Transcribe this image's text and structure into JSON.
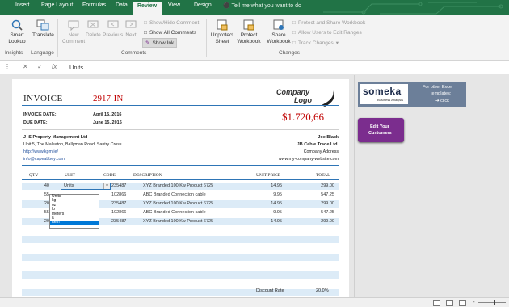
{
  "ribbon_tabs": [
    "Insert",
    "Page Layout",
    "Formulas",
    "Data",
    "Review",
    "View",
    "Design"
  ],
  "active_tab": "Review",
  "tell_me": "Tell me what you want to do",
  "ribbon": {
    "smart_lookup": "Smart Lookup",
    "translate": "Translate",
    "new_comment": "New Comment",
    "delete": "Delete",
    "previous": "Previous",
    "next": "Next",
    "show_hide_comment": "Show/Hide Comment",
    "show_all_comments": "Show All Comments",
    "show_ink": "Show Ink",
    "unprotect_sheet": "Unprotect Sheet",
    "protect_workbook": "Protect Workbook",
    "share_workbook": "Share Workbook",
    "protect_share_workbook": "Protect and Share Workbook",
    "allow_users": "Allow Users to Edit Ranges",
    "track_changes": "Track Changes",
    "groups": [
      "Insights",
      "Language",
      "Comments",
      "Changes"
    ]
  },
  "formula_bar": {
    "value": "Units"
  },
  "invoice": {
    "title": "INVOICE",
    "number": "2917-IN",
    "logo_line1": "Company",
    "logo_line2": "Logo",
    "invoice_date_label": "INVOICE DATE:",
    "invoice_date": "April 15, 2016",
    "due_date_label": "DUE DATE:",
    "due_date": "June 15, 2016",
    "total_big": "$1.720,66",
    "from": {
      "name": "J+S Property Management Ltd",
      "address": "Unit 5, The Maleaton, Ballyman Road, Santry Cross",
      "web": "http://www.kpm.ie/",
      "email": "info@capeabbey.com"
    },
    "to": {
      "person": "Joe Black",
      "company": "JB Cable Trade Ltd.",
      "address": "Company Address",
      "web": "www.my-company-website.com"
    },
    "headers": [
      "QTY",
      "UNIT",
      "CODE",
      "DESCRIPTION",
      "UNIT PRICE",
      "TOTAL"
    ],
    "rows": [
      {
        "qty": "40",
        "unit": "Units",
        "code": "235487",
        "desc": "XYZ Branded 100 Kw Product 6725",
        "price": "14.95",
        "total": "299.00"
      },
      {
        "qty": "55",
        "unit": "",
        "code": "102866",
        "desc": "ABC Branded Connection cable",
        "price": "9.95",
        "total": "547.25"
      },
      {
        "qty": "20",
        "unit": "",
        "code": "235487",
        "desc": "XYZ Branded 100 Kw Product 6725",
        "price": "14.95",
        "total": "299.00"
      },
      {
        "qty": "55",
        "unit": "",
        "code": "102866",
        "desc": "ABC Branded Connection cable",
        "price": "9.95",
        "total": "547.25"
      },
      {
        "qty": "20",
        "unit": "Units",
        "code": "235487",
        "desc": "XYZ Branded 100 Kw Product 6725",
        "price": "14.95",
        "total": "299.00"
      }
    ],
    "unit_options": [
      "Units",
      "kg",
      "oz",
      "lb",
      "meters",
      "ft",
      "Item"
    ],
    "unit_selected": "Item",
    "discount_label": "Discount Rate",
    "discount_value": "20.0%"
  },
  "promo": {
    "brand": "someka",
    "brand_sub": "Business Analysis",
    "text1": "For other Excel",
    "text2": "templates:",
    "link": "click"
  },
  "edit_button": {
    "line1": "Edit Your",
    "line2": "Customers"
  },
  "colors": {
    "excel_green": "#217346",
    "invoice_red": "#c00000",
    "accent_blue": "#2e75b6",
    "row_shade": "#dcebf7",
    "promo_bg": "#6c7f99",
    "edit_btn": "#7b2d8e"
  }
}
